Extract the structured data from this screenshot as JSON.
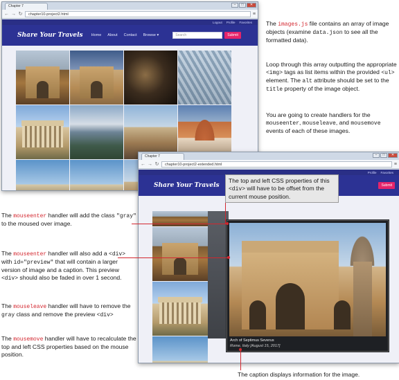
{
  "window1": {
    "tab_title": "Chapter 7",
    "url": "chapter10-project2.html"
  },
  "window2": {
    "tab_title": "Chapter 7",
    "url": "chapter10-project2-extended.html"
  },
  "site": {
    "brand": "Share Your Travels",
    "top_links": [
      "Logout",
      "Profile",
      "Favorites"
    ],
    "top_links_win2": [
      "Profile",
      "Favorites"
    ],
    "nav": [
      "Home",
      "About",
      "Contact",
      "Browse"
    ],
    "browse_caret": "▾",
    "search_placeholder": "Search",
    "submit_label": "Submit"
  },
  "preview": {
    "caption_title": "Arch of Septimus Severus",
    "caption_sub": "Rome, Italy [August 15, 2017]"
  },
  "annotations": {
    "right1": {
      "p1": "The ",
      "code1": "images.js",
      "p2": " file contains an array of image objects (examine ",
      "code2": "data.json",
      "p3": " to see all the formatted data)."
    },
    "right2": {
      "p1": "Loop through this array outputting the appropriate ",
      "code1": "<img>",
      "p2": " tags as list items within the provided ",
      "code2": "<ul>",
      "p3": " element. The ",
      "code3": "alt",
      "p4": " attribute should be set to the ",
      "code4": "title",
      "p5": " property of the image object."
    },
    "right3": {
      "p1": "You are going to create handlers for the ",
      "code1": "mouseenter",
      "p2": ", ",
      "code2": "mouseleave",
      "p3": ", and ",
      "code3": "mousemove",
      "p4": " events of each of these images."
    },
    "callout": {
      "p1": "The top and left CSS properties of this ",
      "code1": "<div>",
      "p2": " will have to be offset from the current mouse position."
    },
    "left1": {
      "p1": "The ",
      "code1": "mouseenter",
      "p2": " handler will add the class ",
      "code2": "\"gray\"",
      "p3": " to the moused over image."
    },
    "left2": {
      "p1": "The ",
      "code1": "mouseenter",
      "p2": " handler will also add a ",
      "code2": "<div>",
      "p3": " with ",
      "code3": "id=\"preview\"",
      "p4": " that will contain a larger version of image and a caption. This preview ",
      "code4": "<div>",
      "p5": " should also be faded in over 1 second."
    },
    "left3": {
      "p1": "The ",
      "code1": "mouseleave",
      "p2": " handler will have to remove the ",
      "code2": "gray",
      "p3": " class and remove the preview ",
      "code3": "<div>"
    },
    "left4": {
      "p1": "The ",
      "code1": "mousemove",
      "p2": " handler will have to recalculate the top and left CSS properties based on the mouse position."
    },
    "bottom": "The caption displays information for the image."
  },
  "colors": {
    "accent_red": "#d3262e",
    "header_blue": "#2c3294",
    "submit_pink": "#e5246a"
  }
}
